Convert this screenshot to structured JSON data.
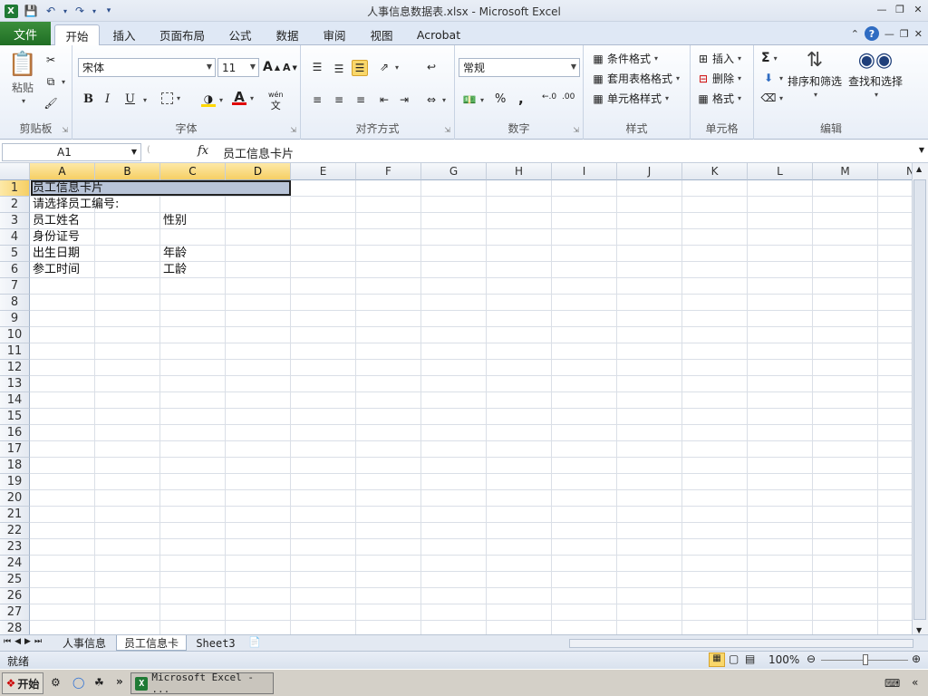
{
  "window": {
    "title": "人事信息数据表.xlsx  -  Microsoft Excel"
  },
  "tabs": {
    "file": "文件",
    "items": [
      "开始",
      "插入",
      "页面布局",
      "公式",
      "数据",
      "审阅",
      "视图",
      "Acrobat"
    ]
  },
  "ribbon": {
    "clipboard": {
      "label": "剪贴板",
      "paste": "粘贴"
    },
    "font": {
      "label": "字体",
      "name": "宋体",
      "size": "11",
      "bold": "B",
      "italic": "I",
      "underline": "U",
      "phonetic": "wén"
    },
    "alignment": {
      "label": "对齐方式"
    },
    "number": {
      "label": "数字",
      "format": "常规",
      "percent": "%",
      "comma": ","
    },
    "styles": {
      "label": "样式",
      "conditional": "条件格式",
      "table": "套用表格格式",
      "cell": "单元格样式"
    },
    "cells": {
      "label": "单元格",
      "insert": "插入",
      "delete": "删除",
      "format": "格式"
    },
    "editing": {
      "label": "编辑",
      "sort": "排序和筛选",
      "find": "查找和选择",
      "sigma": "Σ"
    }
  },
  "formula_bar": {
    "name_box": "A1",
    "fx": "fx",
    "content": "员工信息卡片"
  },
  "grid": {
    "columns": [
      "A",
      "B",
      "C",
      "D",
      "E",
      "F",
      "G",
      "H",
      "I",
      "J",
      "K",
      "L",
      "M",
      "N"
    ],
    "rows": [
      "1",
      "2",
      "3",
      "4",
      "5",
      "6",
      "7",
      "8",
      "9",
      "10",
      "11",
      "12",
      "13",
      "14",
      "15",
      "16",
      "17",
      "18",
      "19",
      "20",
      "21",
      "22",
      "23",
      "24",
      "25",
      "26",
      "27",
      "28"
    ],
    "cells": {
      "A1": "员工信息卡片",
      "A2": "请选择员工编号:",
      "A3": "员工姓名",
      "C3": "性别",
      "A4": "身份证号",
      "A5": "出生日期",
      "C5": "年龄",
      "A6": "参工时间",
      "C6": "工龄"
    }
  },
  "sheets": {
    "tabs": [
      "人事信息",
      "员工信息卡",
      "Sheet3"
    ],
    "active": "员工信息卡"
  },
  "status": {
    "ready": "就绪",
    "zoom": "100%"
  },
  "taskbar": {
    "start": "开始",
    "task": "Microsoft Excel - ..."
  }
}
